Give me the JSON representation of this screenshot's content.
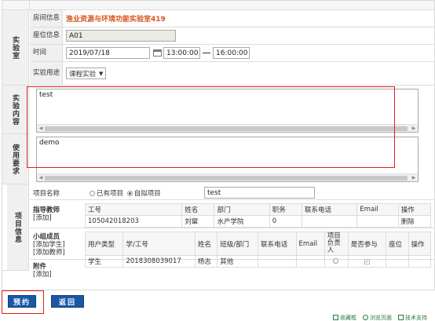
{
  "lab_section": {
    "label": "实验室",
    "room_label": "房间信息",
    "room_value": "渔业资源与环境功能实验室419",
    "seat_label": "座位信息",
    "seat_value": "A01",
    "time_label": "时间",
    "date_value": "2019/07/18",
    "start_time": "13:00:00",
    "end_time": "16:00:00",
    "purpose_label": "实验用途",
    "purpose_value": "课程实验"
  },
  "content_section": {
    "label": "实验内容",
    "text": "test"
  },
  "requirement_section": {
    "label": "使用要求",
    "text": "demo"
  },
  "project_section": {
    "label": "项目信息",
    "name_label": "项目名称",
    "option_existing": "已有项目",
    "option_custom": "自拟项目",
    "name_value": "test",
    "teacher_label": "指导教师",
    "teacher_add": "[添加]",
    "teacher_headers": [
      "工号",
      "姓名",
      "部门",
      "职务",
      "联系电话",
      "Email",
      "操作"
    ],
    "teacher_row": [
      "105042018203",
      "刘窜",
      "水产学院",
      "0",
      "",
      "",
      "删除"
    ],
    "members_label": "小组成员",
    "add_student": "[添加学生]",
    "add_teacher": "[添加教师]",
    "member_headers": [
      "用户类型",
      "学/工号",
      "姓名",
      "班级/部门",
      "联系电话",
      "Email",
      "项目负责人",
      "是否参与",
      "座位",
      "操作"
    ],
    "member_row": [
      "学生",
      "2018308039017",
      "杨志",
      "其他",
      "",
      "",
      "",
      "",
      "",
      ""
    ],
    "attachment_label": "附件",
    "attachment_add": "[添加]"
  },
  "buttons": {
    "reserve": "预约",
    "back": "返回"
  },
  "footer": {
    "item1": "收藏框",
    "item2": "浏览页面",
    "item3": "技术支持"
  }
}
